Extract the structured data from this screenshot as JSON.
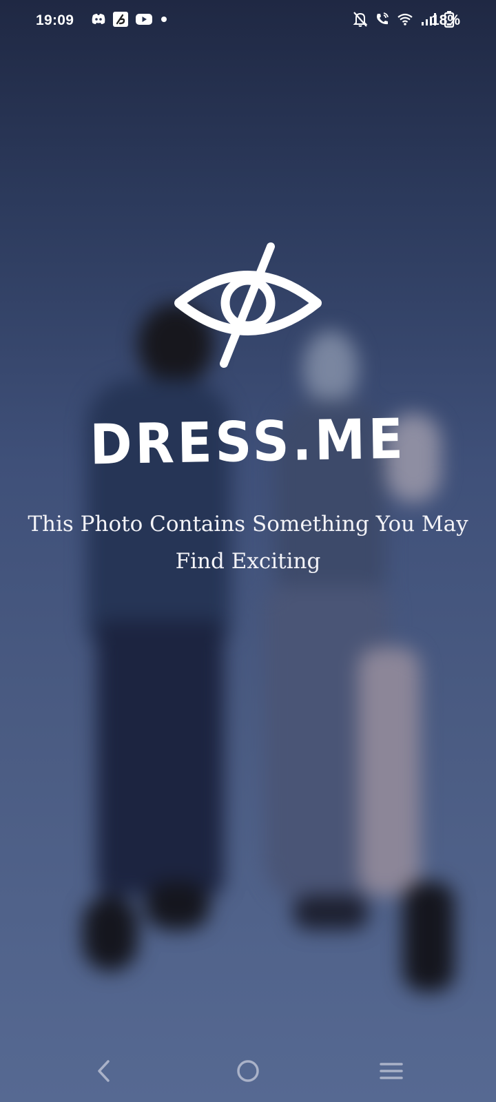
{
  "status_bar": {
    "time": "19:09",
    "notification_icons": [
      "discord-icon",
      "app-b-icon",
      "youtube-icon",
      "dot-icon"
    ],
    "system_icons": [
      "bell-off-icon",
      "wifi-calling-icon",
      "wifi-icon",
      "signal-icon",
      "battery-icon"
    ],
    "battery": "18%"
  },
  "splash": {
    "logo_icon": "crossed-eye-icon",
    "brand": "DRESS.ME",
    "tagline": "This Photo Contains Something You May Find Exciting"
  },
  "nav_bar": {
    "back_icon": "back-chevron-icon",
    "home_icon": "home-circle-icon",
    "recents_icon": "menu-lines-icon"
  },
  "colors": {
    "background_top": "#1f2843",
    "background_bottom": "#566992",
    "foreground": "#ffffff"
  }
}
